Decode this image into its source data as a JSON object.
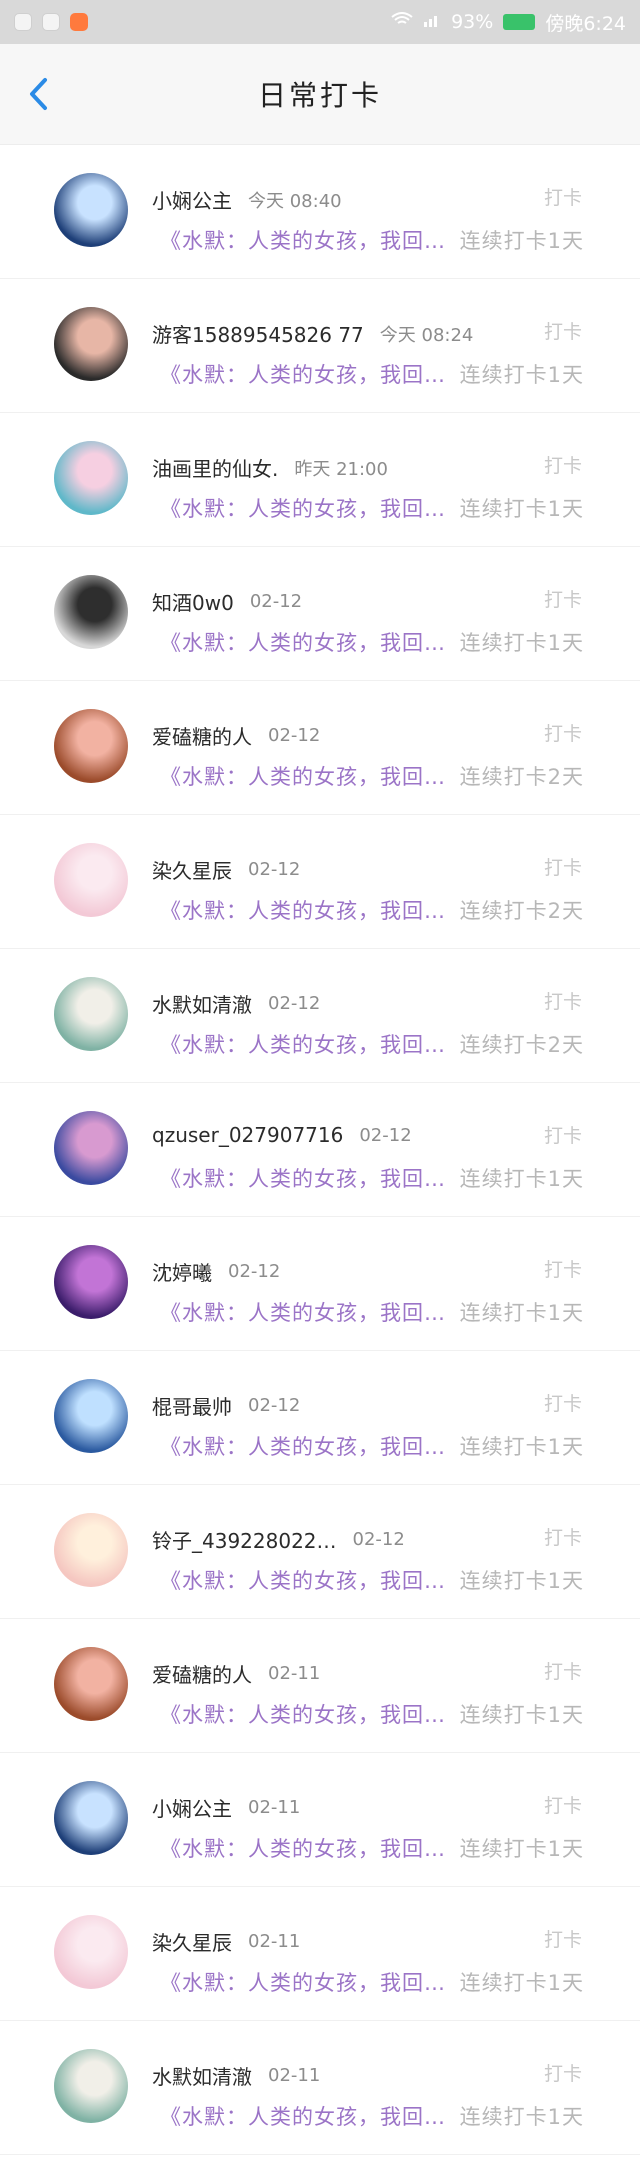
{
  "status": {
    "battery": "93%",
    "time": "傍晚6:24"
  },
  "header": {
    "title": "日常打卡"
  },
  "list": {
    "items": [
      {
        "name": "小娴公主",
        "time": "今天 08:40",
        "action": "打卡",
        "book": "《水默：人类的女孩，我回…",
        "streak": "连续打卡1天",
        "avatar_colors": [
          "#1e3f78",
          "#c8e2ff"
        ]
      },
      {
        "name": "游客15889545826 77",
        "time": "今天 08:24",
        "action": "打卡",
        "book": "《水默：人类的女孩，我回…",
        "streak": "连续打卡1天",
        "avatar_colors": [
          "#2a2a2a",
          "#e7b6a6"
        ]
      },
      {
        "name": "油画里的仙女.",
        "time": "昨天 21:00",
        "action": "打卡",
        "book": "《水默：人类的女孩，我回…",
        "streak": "连续打卡1天",
        "avatar_colors": [
          "#5fb8c9",
          "#f6cfe1"
        ]
      },
      {
        "name": "知酒0w0",
        "time": "02-12",
        "action": "打卡",
        "book": "《水默：人类的女孩，我回…",
        "streak": "连续打卡1天",
        "avatar_colors": [
          "#d8d8d8",
          "#2e2e2e"
        ]
      },
      {
        "name": "爱磕糖的人",
        "time": "02-12",
        "action": "打卡",
        "book": "《水默：人类的女孩，我回…",
        "streak": "连续打卡2天",
        "avatar_colors": [
          "#9b4b2b",
          "#f2b2a2"
        ]
      },
      {
        "name": "染久星辰",
        "time": "02-12",
        "action": "打卡",
        "book": "《水默：人类的女孩，我回…",
        "streak": "连续打卡2天",
        "avatar_colors": [
          "#f3c9d6",
          "#fbeaf0"
        ]
      },
      {
        "name": "水默如清澈",
        "time": "02-12",
        "action": "打卡",
        "book": "《水默：人类的女孩，我回…",
        "streak": "连续打卡2天",
        "avatar_colors": [
          "#7fb2a4",
          "#f1efe8"
        ]
      },
      {
        "name": "qzuser_027907716",
        "time": "02-12",
        "action": "打卡",
        "book": "《水默：人类的女孩，我回…",
        "streak": "连续打卡1天",
        "avatar_colors": [
          "#3a4aa0",
          "#d89ad0"
        ]
      },
      {
        "name": "沈婷曦",
        "time": "02-12",
        "action": "打卡",
        "book": "《水默：人类的女孩，我回…",
        "streak": "连续打卡1天",
        "avatar_colors": [
          "#3b1d6b",
          "#c274d6"
        ]
      },
      {
        "name": "棍哥最帅",
        "time": "02-12",
        "action": "打卡",
        "book": "《水默：人类的女孩，我回…",
        "streak": "连续打卡1天",
        "avatar_colors": [
          "#2b5aa0",
          "#bfe0ff"
        ]
      },
      {
        "name": "铃子_439228022…",
        "time": "02-12",
        "action": "打卡",
        "book": "《水默：人类的女孩，我回…",
        "streak": "连续打卡1天",
        "avatar_colors": [
          "#f5c7c1",
          "#fff0dc"
        ]
      },
      {
        "name": "爱磕糖的人",
        "time": "02-11",
        "action": "打卡",
        "book": "《水默：人类的女孩，我回…",
        "streak": "连续打卡1天",
        "avatar_colors": [
          "#9b4b2b",
          "#f2b2a2"
        ]
      },
      {
        "name": "小娴公主",
        "time": "02-11",
        "action": "打卡",
        "book": "《水默：人类的女孩，我回…",
        "streak": "连续打卡1天",
        "avatar_colors": [
          "#1e3f78",
          "#c8e2ff"
        ]
      },
      {
        "name": "染久星辰",
        "time": "02-11",
        "action": "打卡",
        "book": "《水默：人类的女孩，我回…",
        "streak": "连续打卡1天",
        "avatar_colors": [
          "#f3c9d6",
          "#fbeaf0"
        ]
      },
      {
        "name": "水默如清澈",
        "time": "02-11",
        "action": "打卡",
        "book": "《水默：人类的女孩，我回…",
        "streak": "连续打卡1天",
        "avatar_colors": [
          "#7fb2a4",
          "#f1efe8"
        ]
      }
    ]
  }
}
